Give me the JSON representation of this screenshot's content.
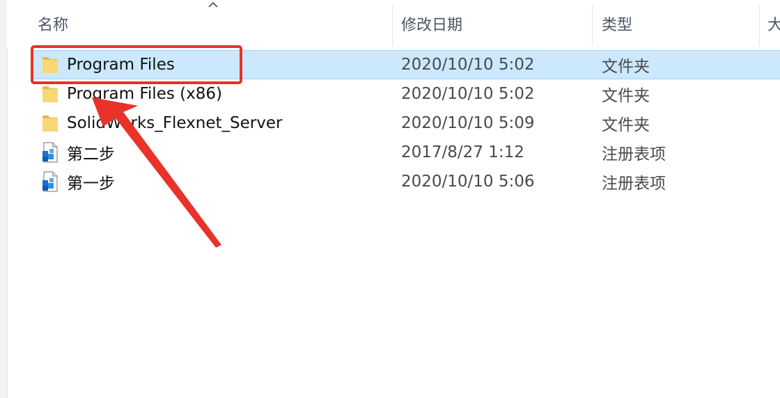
{
  "columns": {
    "name": "名称",
    "date": "修改日期",
    "type": "类型",
    "size": "大"
  },
  "files": [
    {
      "name": "Program Files",
      "date": "2020/10/10 5:02",
      "type": "文件夹",
      "icon": "folder-icon",
      "selected": true
    },
    {
      "name": "Program Files (x86)",
      "date": "2020/10/10 5:02",
      "type": "文件夹",
      "icon": "folder-icon",
      "selected": false
    },
    {
      "name": "SolidWorks_Flexnet_Server",
      "date": "2020/10/10 5:09",
      "type": "文件夹",
      "icon": "folder-icon",
      "selected": false
    },
    {
      "name": "第二步",
      "date": "2017/8/27 1:12",
      "type": "注册表项",
      "icon": "registry-file-icon",
      "selected": false
    },
    {
      "name": "第一步",
      "date": "2020/10/10 5:06",
      "type": "注册表项",
      "icon": "registry-file-icon",
      "selected": false
    }
  ],
  "colors": {
    "selection_bg": "#cce8ff",
    "selection_border": "#99d1ff",
    "annotation_red": "#e8322a",
    "folder_yellow": "#f8d775"
  }
}
